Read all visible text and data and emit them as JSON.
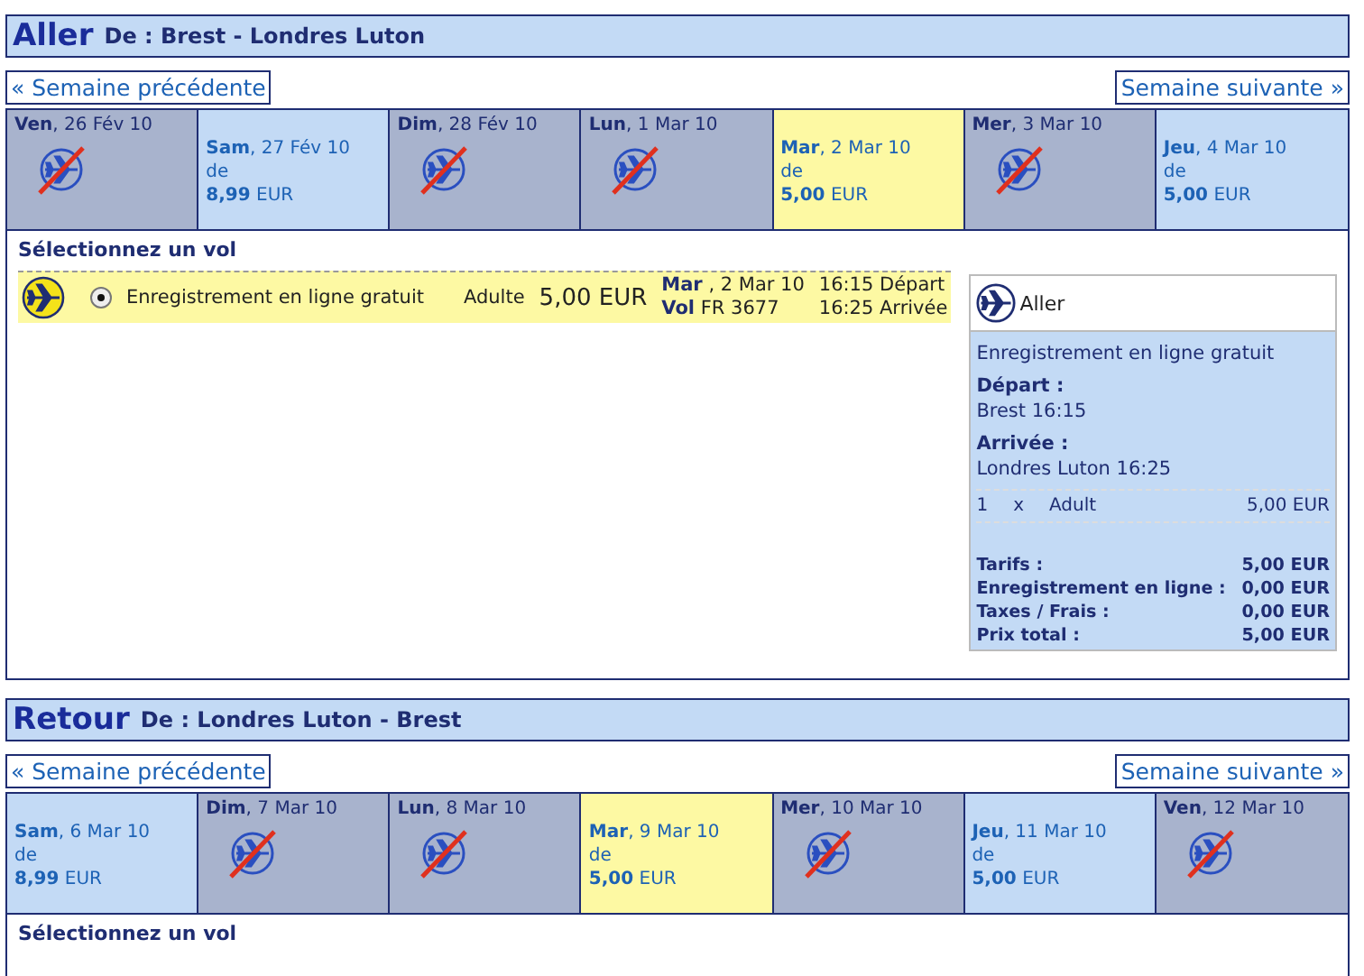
{
  "outbound": {
    "title": "Aller",
    "route": "De : Brest - Londres Luton",
    "prev_week": "« Semaine précédente",
    "next_week": "Semaine suivante »",
    "days": [
      {
        "day": "Ven",
        "date": ", 26 Fév 10",
        "available": false,
        "selected": false
      },
      {
        "day": "Sam",
        "date": ", 27 Fév 10",
        "available": true,
        "selected": false,
        "from": "de",
        "price": "8,99",
        "currency": "EUR"
      },
      {
        "day": "Dim",
        "date": ", 28 Fév 10",
        "available": false,
        "selected": false
      },
      {
        "day": "Lun",
        "date": ", 1 Mar 10",
        "available": false,
        "selected": false
      },
      {
        "day": "Mar",
        "date": ", 2 Mar 10",
        "available": true,
        "selected": true,
        "from": "de",
        "price": "5,00",
        "currency": "EUR"
      },
      {
        "day": "Mer",
        "date": ", 3 Mar 10",
        "available": false,
        "selected": false
      },
      {
        "day": "Jeu",
        "date": ", 4 Mar 10",
        "available": true,
        "selected": false,
        "from": "de",
        "price": "5,00",
        "currency": "EUR"
      }
    ],
    "select_heading": "Sélectionnez un vol",
    "flights": [
      {
        "selected": true,
        "fare": "Enregistrement en ligne gratuit",
        "passenger": "Adulte",
        "price": "5,00 EUR",
        "day": "Mar",
        "date": ", 2 Mar 10",
        "flight_label": "Vol",
        "flight_no": "FR 3677",
        "departure": "16:15 Départ",
        "arrival": "16:25 Arrivée"
      }
    ],
    "summary": {
      "title": "Aller",
      "fare": "Enregistrement en ligne gratuit",
      "departure_label": "Départ :",
      "departure": "Brest 16:15",
      "arrival_label": "Arrivée :",
      "arrival": "Londres Luton 16:25",
      "line": {
        "qty": "1",
        "x": "x",
        "type": "Adult",
        "amount": "5,00 EUR"
      },
      "totals": [
        {
          "label": "Tarifs :",
          "value": "5,00 EUR"
        },
        {
          "label": "Enregistrement en ligne :",
          "value": "0,00 EUR"
        },
        {
          "label": "Taxes / Frais :",
          "value": "0,00 EUR"
        },
        {
          "label": "Prix total :",
          "value": "5,00 EUR"
        }
      ]
    }
  },
  "inbound": {
    "title": "Retour",
    "route": "De : Londres Luton - Brest",
    "prev_week": "« Semaine précédente",
    "next_week": "Semaine suivante »",
    "days": [
      {
        "day": "Sam",
        "date": ", 6 Mar 10",
        "available": true,
        "selected": false,
        "from": "de",
        "price": "8,99",
        "currency": "EUR"
      },
      {
        "day": "Dim",
        "date": ", 7 Mar 10",
        "available": false,
        "selected": false
      },
      {
        "day": "Lun",
        "date": ", 8 Mar 10",
        "available": false,
        "selected": false
      },
      {
        "day": "Mar",
        "date": ", 9 Mar 10",
        "available": true,
        "selected": true,
        "from": "de",
        "price": "5,00",
        "currency": "EUR"
      },
      {
        "day": "Mer",
        "date": ", 10 Mar 10",
        "available": false,
        "selected": false
      },
      {
        "day": "Jeu",
        "date": ", 11 Mar 10",
        "available": true,
        "selected": false,
        "from": "de",
        "price": "5,00",
        "currency": "EUR"
      },
      {
        "day": "Ven",
        "date": ", 12 Mar 10",
        "available": false,
        "selected": false
      }
    ],
    "select_heading": "Sélectionnez un vol"
  }
}
